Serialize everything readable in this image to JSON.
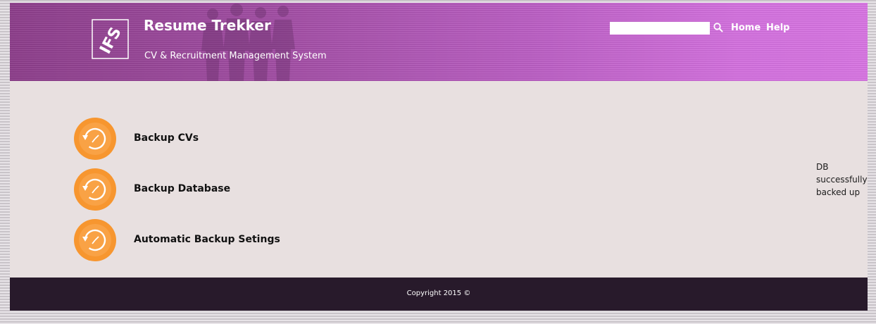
{
  "colors": {
    "header_start": "#8e3f8c",
    "header_end": "#d976e4",
    "content_bg": "#e8e0e0",
    "footer_bg": "#281a2b",
    "icon_orange": "#f7962f"
  },
  "header": {
    "logo_text": "IFS",
    "title": "Resume Trekker",
    "subtitle": "CV & Recruitment Management System",
    "search": {
      "value": "",
      "placeholder": "",
      "icon": "search-icon"
    },
    "nav": {
      "home": "Home",
      "help": "Help"
    }
  },
  "menu": {
    "items": [
      {
        "label": "Backup CVs",
        "icon": "backup-icon"
      },
      {
        "label": "Backup Database",
        "icon": "backup-icon"
      },
      {
        "label": "Automatic Backup Setings",
        "icon": "backup-icon"
      }
    ]
  },
  "status": {
    "message": "DB successfully backed up"
  },
  "footer": {
    "copyright": "Copyright 2015 ©"
  }
}
